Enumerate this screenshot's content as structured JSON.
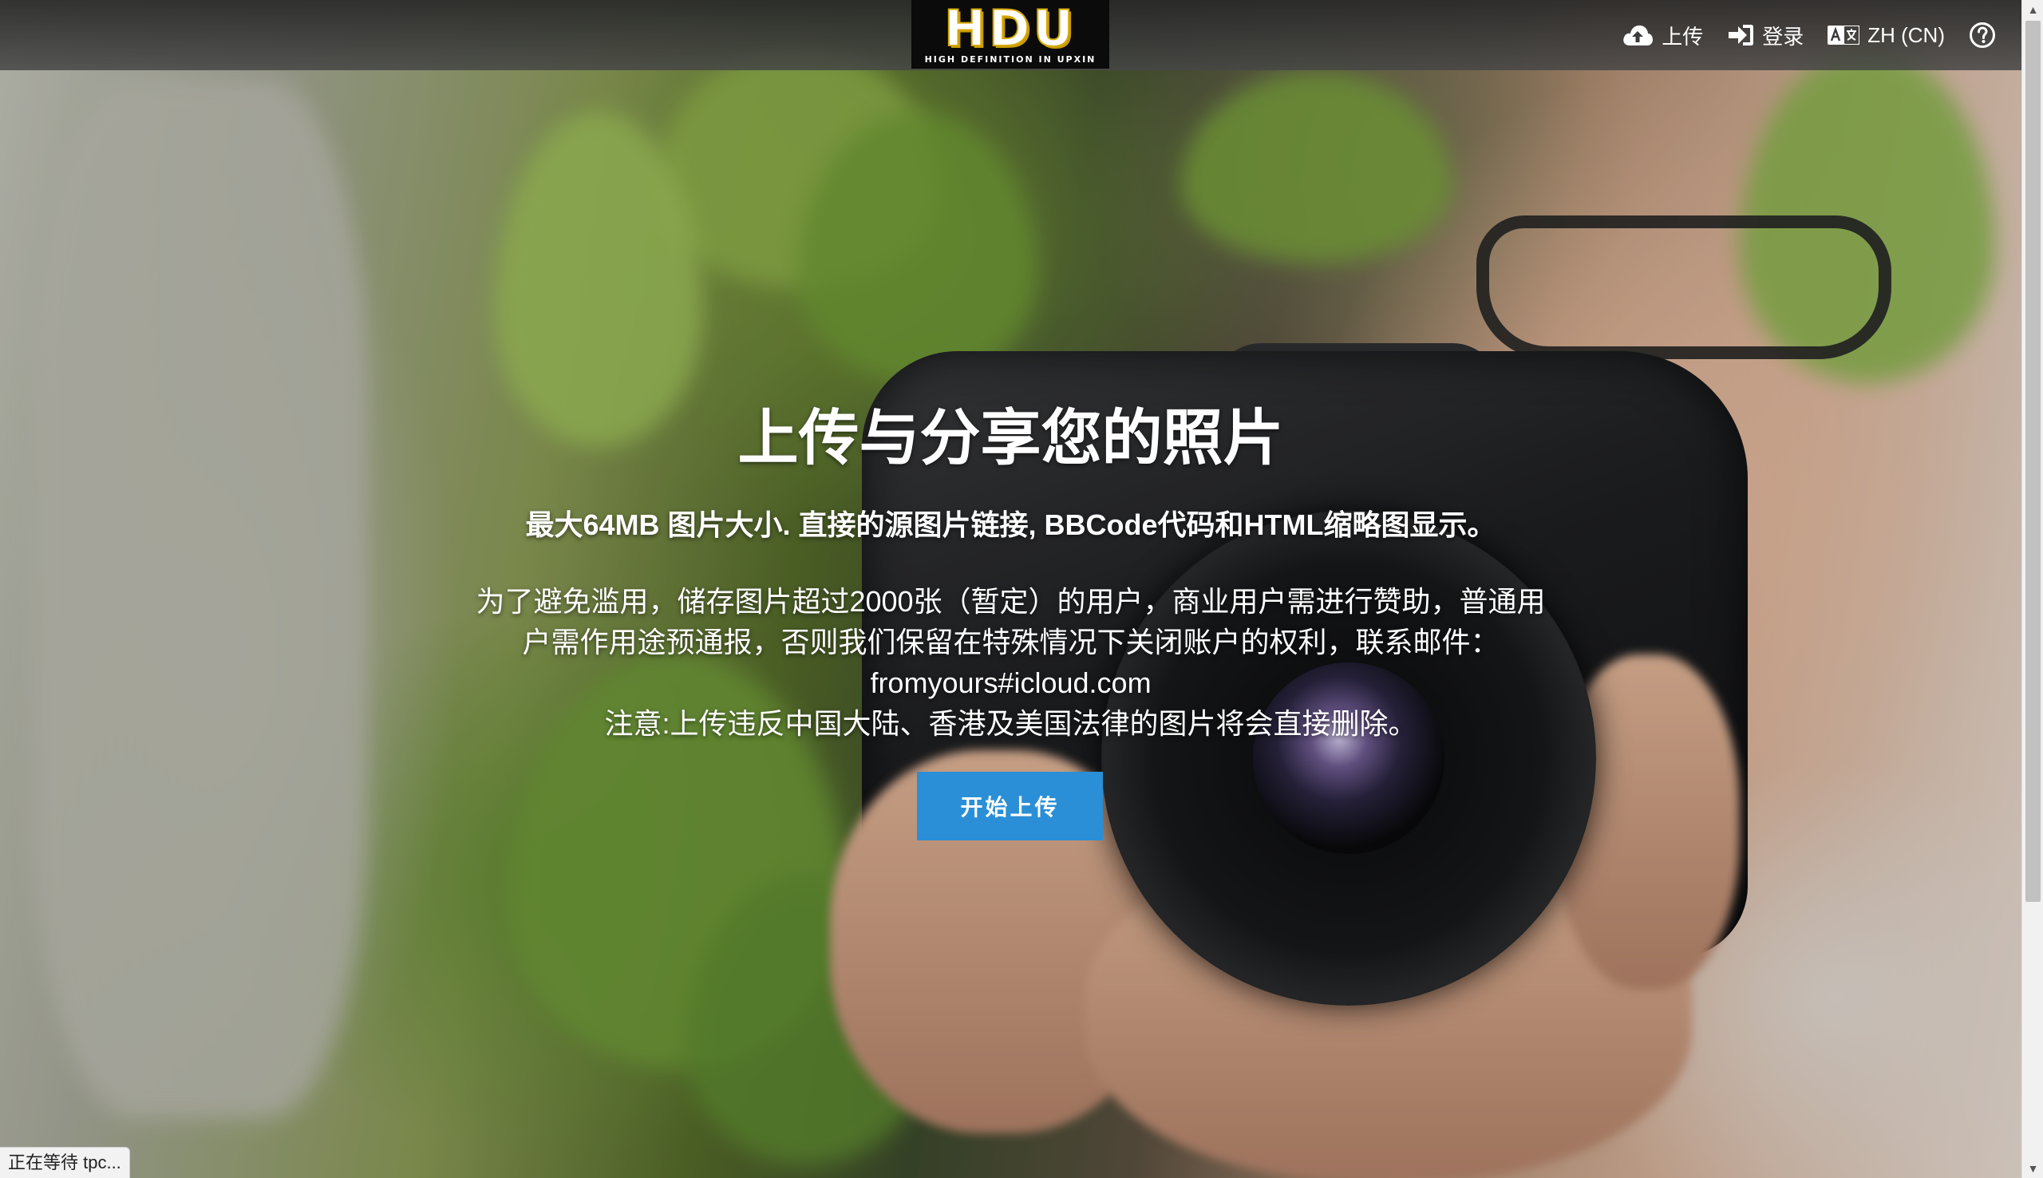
{
  "header": {
    "logo": {
      "mark": "HDU",
      "tagline": "HIGH DEFINITION IN UPXIN"
    },
    "nav": [
      {
        "id": "upload",
        "label": "上传",
        "icon": "cloud-upload-icon"
      },
      {
        "id": "login",
        "label": "登录",
        "icon": "sign-in-icon"
      },
      {
        "id": "language",
        "label": "ZH (CN)",
        "icon": "translate-icon"
      },
      {
        "id": "help",
        "label": "",
        "icon": "help-circle-icon"
      }
    ]
  },
  "hero": {
    "title": "上传与分享您的照片",
    "subtitle": "最大64MB 图片大小. 直接的源图片链接, BBCode代码和HTML缩略图显示。",
    "description": "为了避免滥用，储存图片超过2000张（暂定）的用户，商业用户需进行赞助，普通用户需作用途预通报，否则我们保留在特殊情况下关闭账户的权利，联系邮件：fromyours#icloud.com",
    "notice": "注意:上传违反中国大陆、香港及美国法律的图片将会直接删除。",
    "cta_label": "开始上传"
  },
  "status": {
    "text": "正在等待 tpc..."
  },
  "colors": {
    "accent": "#2a8fd6",
    "logo_yellow": "#d6a800",
    "topbar": "#3a3a3a"
  }
}
